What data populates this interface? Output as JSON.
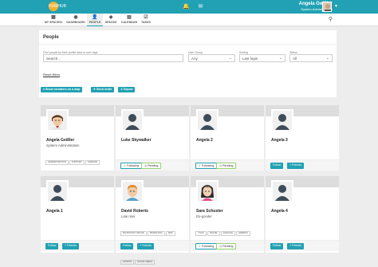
{
  "header": {
    "logo_text": "HUMHUB",
    "user_name": "Angela Geißler",
    "user_title": "System Administration",
    "icons": [
      "bell-icon",
      "envelope-icon"
    ]
  },
  "nav": {
    "items": [
      {
        "label": "MY SPACES",
        "icon": "grid-icon",
        "active": false
      },
      {
        "label": "DASHBOARD",
        "icon": "dashboard-icon",
        "active": false
      },
      {
        "label": "PEOPLE",
        "icon": "user-icon",
        "active": true
      },
      {
        "label": "SPACES",
        "icon": "spaces-icon",
        "active": false
      },
      {
        "label": "CALENDAR",
        "icon": "calendar-icon",
        "active": false
      },
      {
        "label": "TASKS",
        "icon": "tasks-icon",
        "active": false
      }
    ]
  },
  "people": {
    "title": "People",
    "filters": {
      "search_label": "Find people by their profile data or user tags",
      "search_placeholder": "Search...",
      "group_label": "User Group",
      "group_value": "Any",
      "sort_label": "Sorting",
      "sort_value": "Last login",
      "status_label": "Status",
      "status_value": "All"
    },
    "reset_label": "Reset filters",
    "actions": [
      "Show members on a map",
      "Send invite",
      "Export"
    ]
  },
  "cards": [
    {
      "name": "Angela Geißler",
      "title": "System Administration",
      "tags": [
        "ADMINISTRATION",
        "SUPPORT",
        "HUMHUB"
      ],
      "buttons": []
    },
    {
      "name": "Luke Skywalker",
      "title": "",
      "tags": [],
      "buttons": [
        "Following",
        "Pending"
      ]
    },
    {
      "name": "Angela 2",
      "title": "",
      "tags": [],
      "buttons": [
        "Following",
        "Pending"
      ]
    },
    {
      "name": "Angela 3",
      "title": "",
      "tags": [],
      "buttons": [
        "Follow",
        "Friends"
      ]
    },
    {
      "name": "Angela 1",
      "title": "",
      "tags": [],
      "buttons": [
        "Follow",
        "Friends"
      ]
    },
    {
      "name": "David Roberts",
      "title": "Late riser",
      "tags": [
        "MICROSOFT OFFICE",
        "MARKETING",
        "SEM",
        "SOCIAL MEDIA",
        "CONTENT MARKETING",
        "PRINT",
        "SPORTS",
        "SOCIAL MEDIA"
      ],
      "buttons": [
        "Follow",
        "Friends"
      ]
    },
    {
      "name": "Sara Schuster",
      "title": "Do-gooder",
      "tags": [
        "YOGA",
        "TRAVEL",
        "ENGLISH",
        "GERMAN",
        "FRENCH",
        "SPANISH"
      ],
      "buttons": [
        "Following",
        "Pending"
      ]
    },
    {
      "name": "Angela 4",
      "title": "",
      "tags": [],
      "buttons": [
        "Follow",
        "Friends"
      ]
    }
  ]
}
